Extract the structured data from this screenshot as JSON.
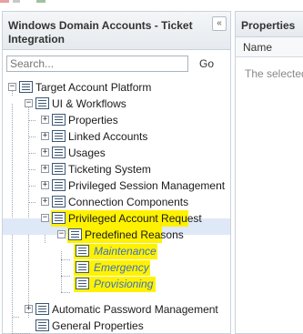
{
  "left_panel": {
    "title": "Windows Domain Accounts - Ticket Integration",
    "collapse_glyph": "«",
    "search": {
      "placeholder": "Search...",
      "value": "",
      "go_label": "Go"
    }
  },
  "tree": {
    "nodes": [
      {
        "label": "Target Account Platform",
        "toggle": "−"
      },
      {
        "label": "UI & Workflows",
        "toggle": "−"
      },
      {
        "label": "Properties",
        "toggle": "+"
      },
      {
        "label": "Linked Accounts",
        "toggle": "+"
      },
      {
        "label": "Usages",
        "toggle": "+"
      },
      {
        "label": "Ticketing System",
        "toggle": "+"
      },
      {
        "label": "Privileged Session Management",
        "toggle": "+"
      },
      {
        "label": "Connection Components",
        "toggle": "+"
      },
      {
        "label": "Privileged Account Request",
        "toggle": "−"
      },
      {
        "label": "Predefined Reasons",
        "toggle": "−"
      },
      {
        "label": "Maintenance"
      },
      {
        "label": "Emergency"
      },
      {
        "label": "Provisioning"
      },
      {
        "label": "Automatic Password Management",
        "toggle": "+"
      },
      {
        "label": "General Properties"
      }
    ]
  },
  "right_panel": {
    "title": "Properties",
    "column_name": "Name",
    "message": "The selected"
  },
  "colors": {
    "highlight": "#fff200",
    "selected_row": "#dfe8f6",
    "italic_link": "#3b6dcc"
  }
}
